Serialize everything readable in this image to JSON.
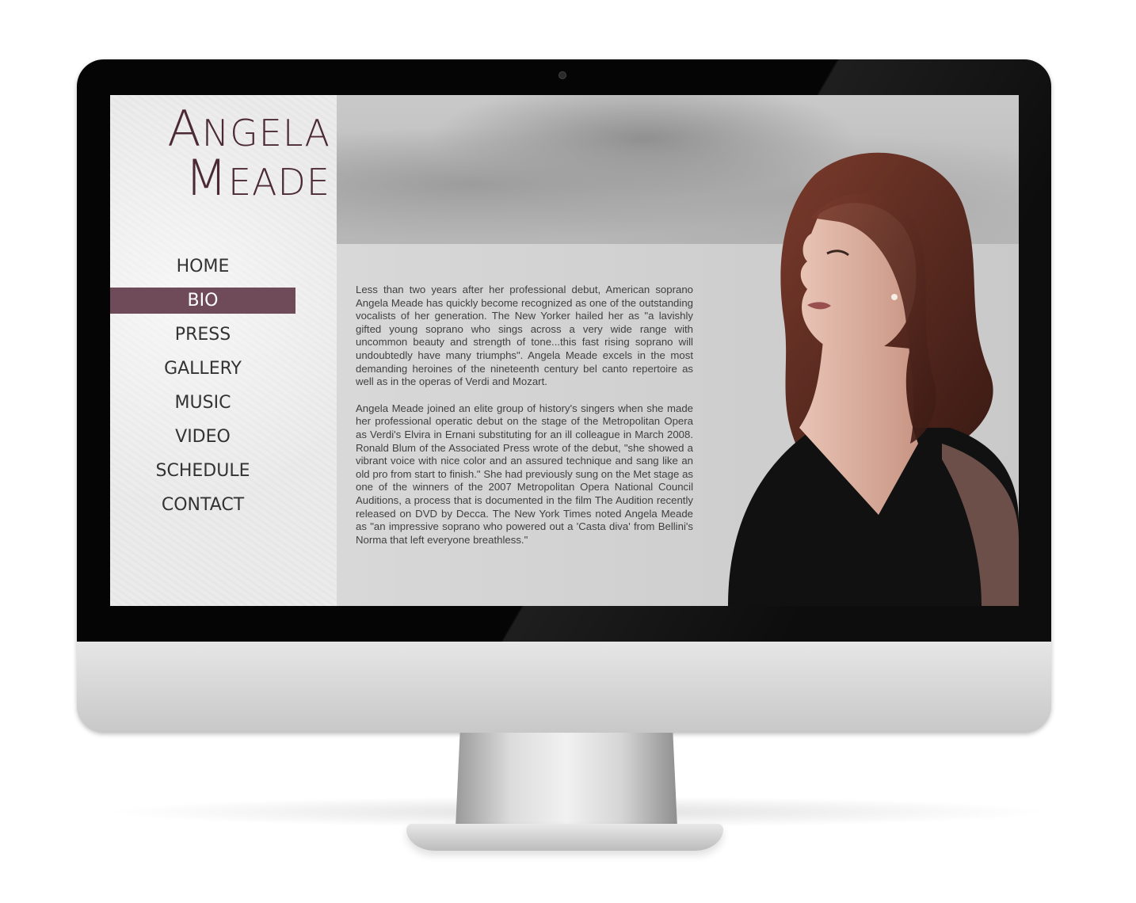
{
  "site": {
    "logo": {
      "line1": "Angela",
      "line2": "Meade"
    },
    "nav": [
      {
        "label": "HOME"
      },
      {
        "label": "BIO"
      },
      {
        "label": "PRESS"
      },
      {
        "label": "GALLERY"
      },
      {
        "label": "MUSIC"
      },
      {
        "label": "VIDEO"
      },
      {
        "label": "SCHEDULE"
      },
      {
        "label": "CONTACT"
      }
    ],
    "active_nav": "BIO",
    "bio": {
      "paragraph1": "Less than two years after her professional debut, American soprano Angela Meade has quickly become recognized as one of the outstanding vocalists of her generation.  The New Yorker hailed her as \"a lavishly gifted young soprano who sings across a very wide range with uncommon beauty and strength of tone...this fast rising soprano will undoubtedly have many triumphs\".  Angela Meade excels in the most demanding heroines of the nineteenth century bel canto repertoire as well as in the operas of Verdi and Mozart.",
      "paragraph2": "Angela Meade joined an elite group of history's singers when she made her professional operatic debut on the stage of the Metropolitan Opera as Verdi's Elvira in Ernani substituting for an ill colleague in March 2008.  Ronald Blum of the Associated Press wrote of the debut, \"she showed a vibrant voice with nice color and an assured technique and sang like an old pro from start to finish.\"  She had previously sung on the Met stage as one of the winners of the 2007 Metropolitan Opera National Council Auditions, a process that is documented in the film The Audition recently released on DVD by Decca.  The New York Times noted Angela Meade as \"an impressive soprano who powered out a 'Casta diva' from Bellini's Norma that left everyone breathless.\""
    }
  },
  "colors": {
    "accent": "#6f4b59",
    "logo": "#4b2a36",
    "text": "#3f3f3f"
  }
}
